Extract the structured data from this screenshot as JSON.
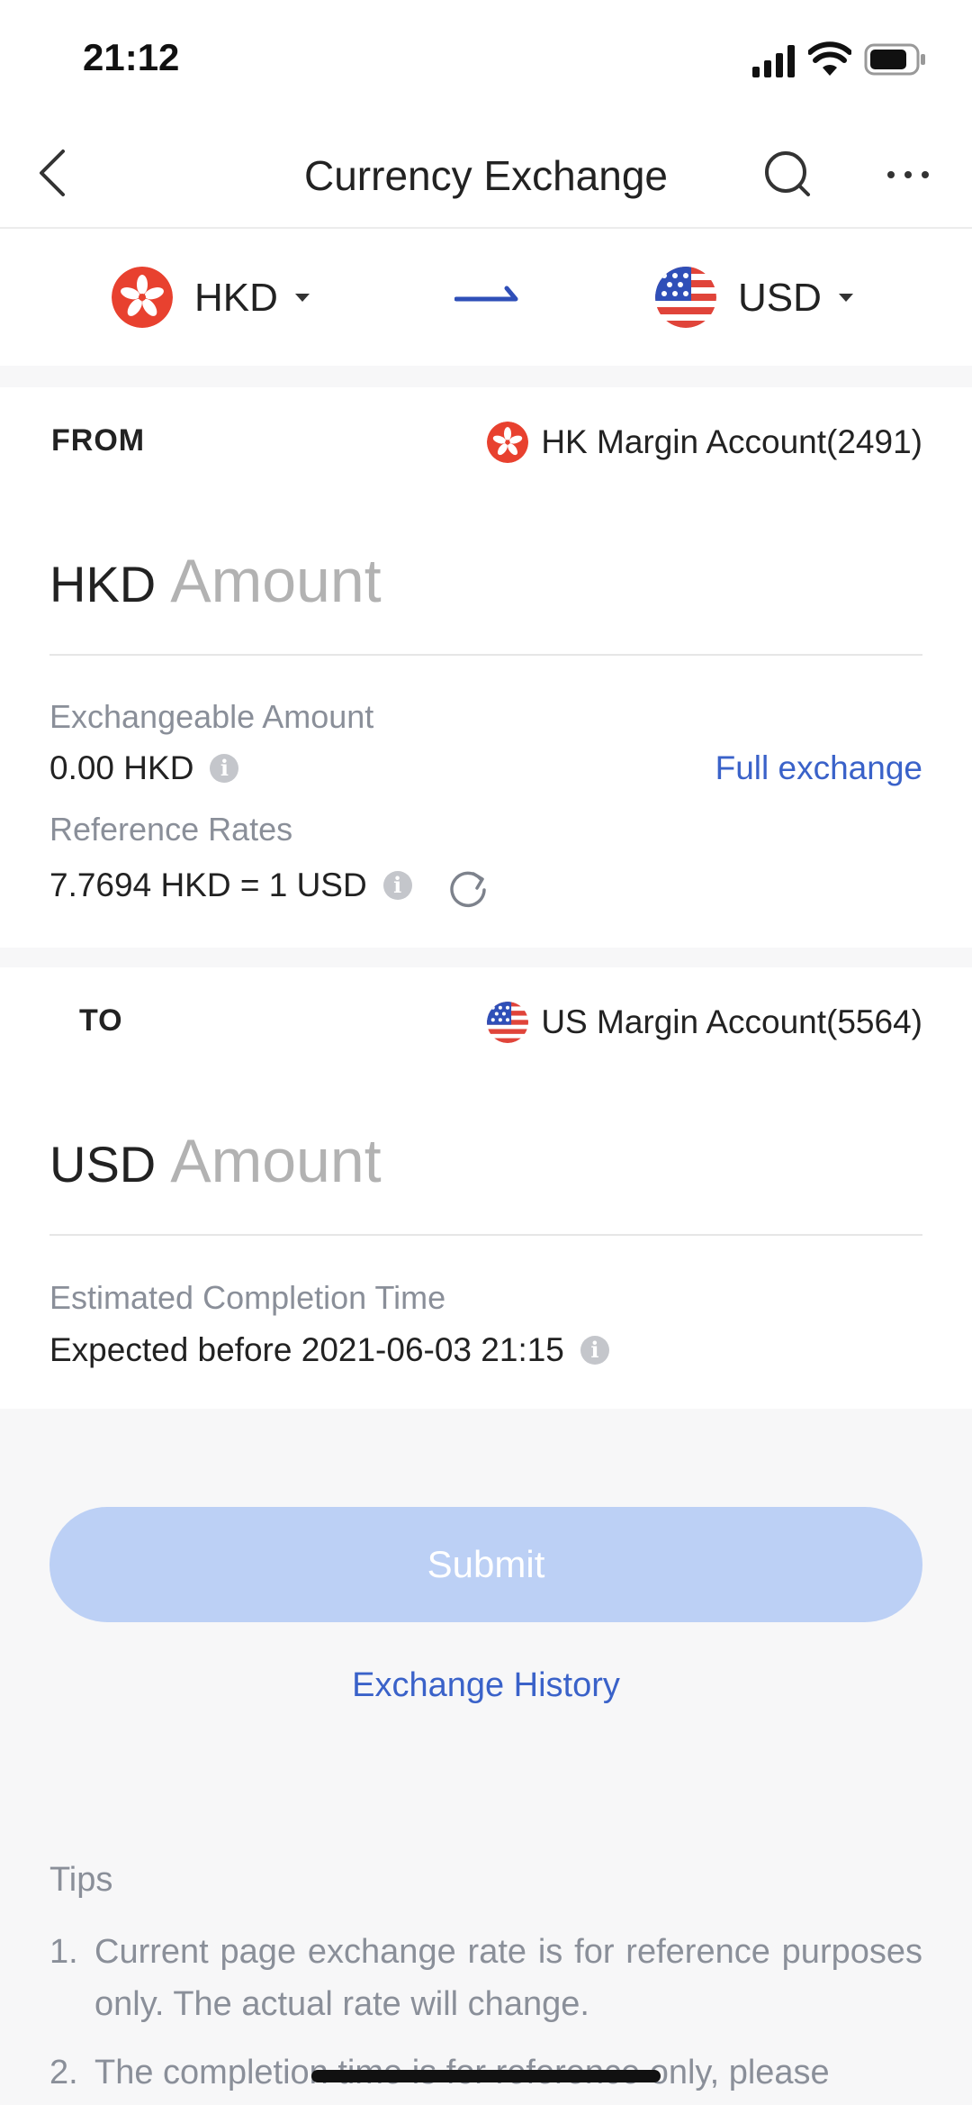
{
  "status_bar": {
    "time": "21:12"
  },
  "nav": {
    "title": "Currency Exchange"
  },
  "selector": {
    "from_code": "HKD",
    "to_code": "USD"
  },
  "from": {
    "label": "FROM",
    "account": "HK Margin Account(2491)",
    "currency": "HKD",
    "amount_placeholder": "Amount",
    "exchangeable_label": "Exchangeable Amount",
    "exchangeable_value": "0.00 HKD",
    "full_exchange": "Full exchange",
    "rates_label": "Reference Rates",
    "rates_value": "7.7694 HKD = 1 USD"
  },
  "to": {
    "label": "TO",
    "account": "US Margin Account(5564)",
    "currency": "USD",
    "amount_placeholder": "Amount",
    "eta_label": "Estimated Completion Time",
    "eta_value": "Expected before 2021-06-03 21:15"
  },
  "actions": {
    "submit": "Submit",
    "history": "Exchange History"
  },
  "tips": {
    "title": "Tips",
    "items": [
      {
        "num": "1.",
        "text": "Current page exchange rate is for reference purposes only. The actual rate will change."
      },
      {
        "num": "2.",
        "text": "The completion time is for reference only, please"
      }
    ]
  },
  "colors": {
    "accent": "#3a62c9",
    "submit_disabled": "#bcd0f5",
    "hk_red": "#e8412f",
    "us_blue": "#2f4fb8"
  }
}
